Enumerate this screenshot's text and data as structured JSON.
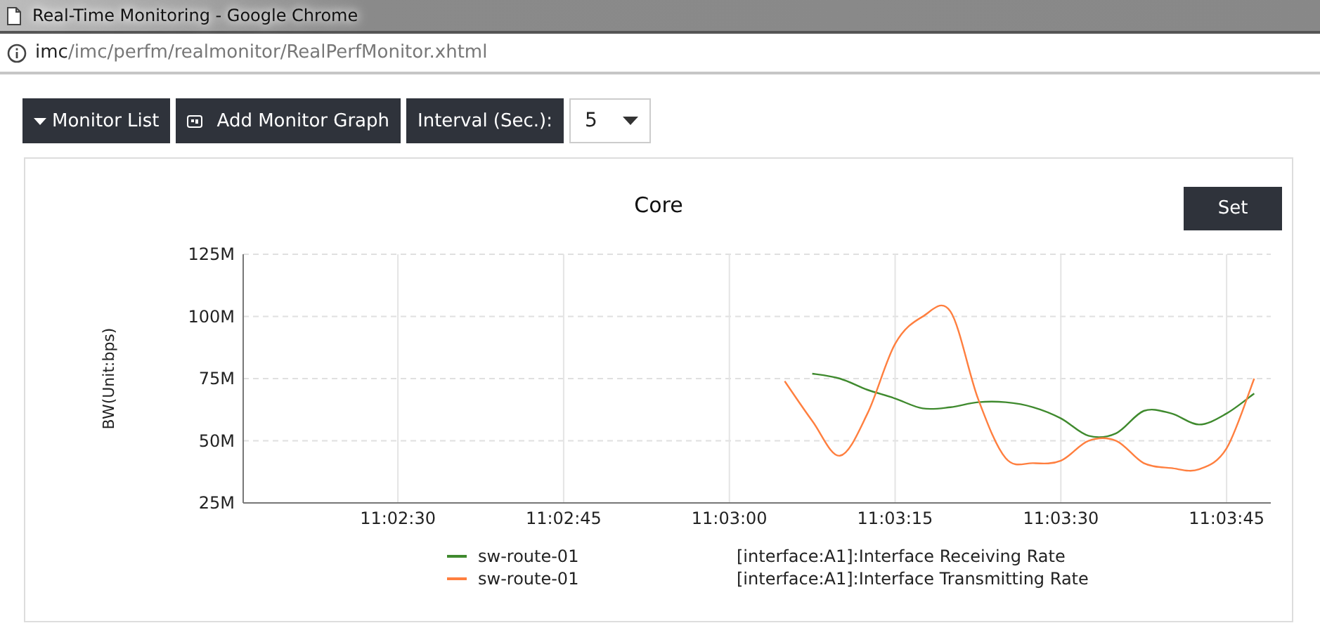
{
  "window": {
    "title": "Real-Time Monitoring - Google Chrome",
    "url_host": "imc",
    "url_path": "/imc/perfm/realmonitor/RealPerfMonitor.xhtml"
  },
  "toolbar": {
    "monitor_list": "Monitor List",
    "add_graph": "Add Monitor Graph",
    "interval_label": "Interval (Sec.):",
    "interval_value": "5"
  },
  "panel": {
    "title": "Core",
    "set_button": "Set",
    "chart_data": {
      "type": "line",
      "grid": true,
      "ylabel": "BW(Unit:bps)",
      "ylim": [
        25,
        125
      ],
      "categories": [
        null,
        null,
        null,
        null,
        null,
        "11:02:30",
        null,
        null,
        null,
        null,
        null,
        "11:02:45",
        null,
        null,
        null,
        null,
        null,
        "11:03:00",
        null,
        null,
        null,
        null,
        null,
        "11:03:15",
        null,
        null,
        null,
        null,
        null,
        "11:03:30",
        null,
        null,
        null,
        null,
        null,
        "11:03:45",
        null
      ],
      "yticks": [
        {
          "value": 25,
          "label": "25M"
        },
        {
          "value": 50,
          "label": "50M"
        },
        {
          "value": 75,
          "label": "75M"
        },
        {
          "value": 100,
          "label": "100M"
        },
        {
          "value": 125,
          "label": "125M"
        }
      ],
      "series": [
        {
          "name": "[interface:A1]:Interface Receiving Rate",
          "color": "#3f8a2e",
          "values": [
            null,
            null,
            null,
            null,
            null,
            null,
            null,
            null,
            null,
            null,
            null,
            null,
            null,
            null,
            null,
            null,
            null,
            null,
            null,
            null,
            77,
            75,
            70.5,
            67,
            63,
            63.5,
            65.5,
            65.5,
            63.5,
            59,
            52,
            53,
            62,
            61,
            56.5,
            61,
            69
          ]
        },
        {
          "name": "[interface:A1]:Interface Transmitting Rate",
          "color": "#ff7f3f",
          "values": [
            null,
            null,
            null,
            null,
            null,
            null,
            null,
            null,
            null,
            null,
            null,
            null,
            null,
            null,
            null,
            null,
            null,
            null,
            null,
            74,
            58,
            44,
            61,
            89,
            100,
            102,
            67,
            43,
            41,
            42,
            50,
            50,
            41,
            39,
            38.5,
            47,
            75
          ]
        }
      ]
    },
    "legend_devices": [
      "sw-route-01",
      "sw-route-01"
    ]
  }
}
